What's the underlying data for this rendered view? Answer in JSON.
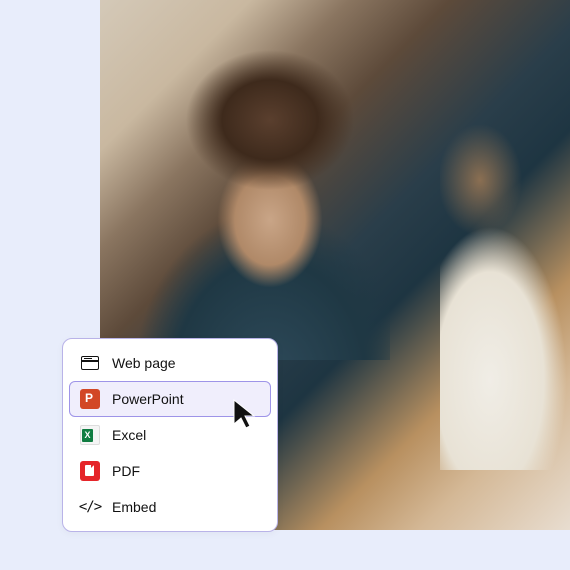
{
  "menu": {
    "items": [
      {
        "label": "Web page",
        "icon": "webpage-icon",
        "selected": false
      },
      {
        "label": "PowerPoint",
        "icon": "powerpoint-icon",
        "selected": true
      },
      {
        "label": "Excel",
        "icon": "excel-icon",
        "selected": false
      },
      {
        "label": "PDF",
        "icon": "pdf-icon",
        "selected": false
      },
      {
        "label": "Embed",
        "icon": "embed-icon",
        "selected": false
      }
    ]
  }
}
